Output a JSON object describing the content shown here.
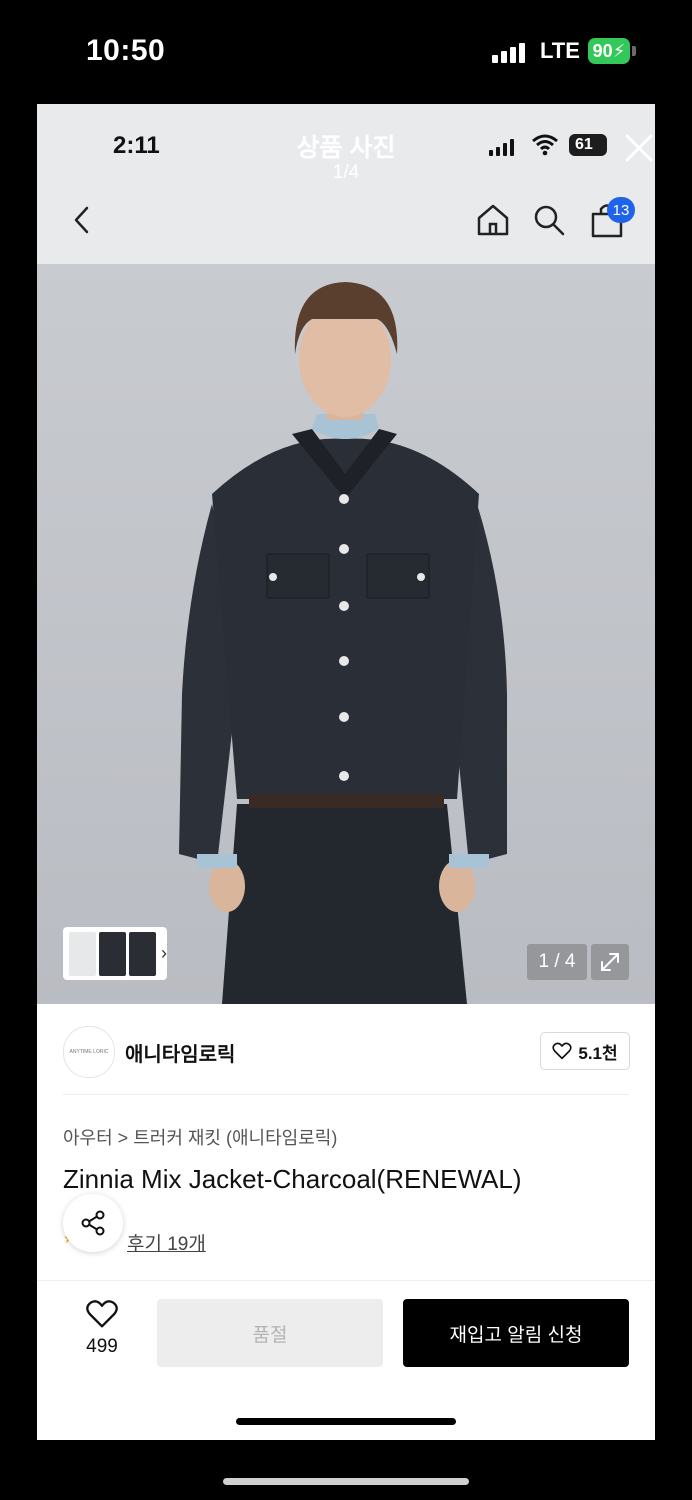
{
  "outer_status": {
    "time": "10:50",
    "network": "LTE",
    "battery": "90"
  },
  "inner_status": {
    "time": "2:11",
    "battery": "61"
  },
  "photo_header": {
    "title": "상품 사진",
    "counter": "1/4"
  },
  "nav_icons": [
    "back-icon",
    "home-icon",
    "search-icon",
    "shopping-bag-icon"
  ],
  "cart_badge": "13",
  "gallery": {
    "counter": "1 / 4"
  },
  "brand": {
    "name": "애니타임로릭",
    "logo_text": "ANYTIME LORIC",
    "likes": "5.1천"
  },
  "product": {
    "breadcrumb": "아우터 > 트러커 재킷 (애니타임로릭)",
    "name": "Zinnia Mix Jacket-Charcoal(RENEWAL)",
    "reviews": "후기 19개"
  },
  "bottom_bar": {
    "wish_count": "499",
    "soldout_label": "품절",
    "restock_label": "재입고 알림 신청"
  },
  "colors": {
    "primary": "#000000",
    "badge": "#1e63e9",
    "battery_green": "#34c759"
  }
}
